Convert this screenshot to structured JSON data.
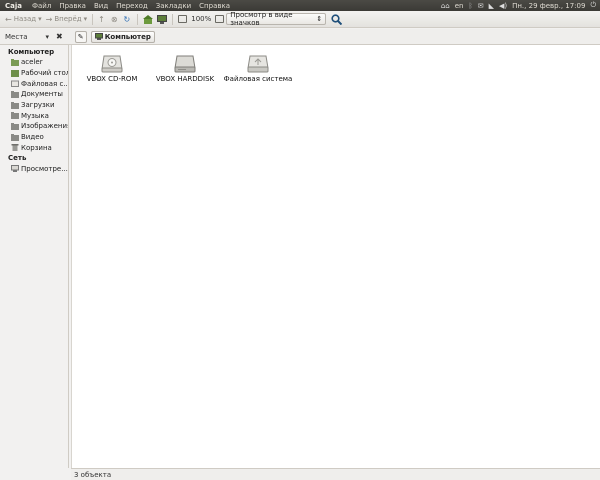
{
  "panel": {
    "app": "Caja",
    "menus": [
      "Файл",
      "Правка",
      "Вид",
      "Переход",
      "Закладки",
      "Справка"
    ],
    "keyboard": "en",
    "clock": "Пн., 29 февр., 17:09"
  },
  "toolbar": {
    "back": "Назад",
    "forward": "Вперёд",
    "zoom": "100%",
    "view_mode": "Просмотр в виде значков"
  },
  "location": {
    "places_label": "Места",
    "breadcrumb": "Компьютер"
  },
  "sidebar": {
    "sections": [
      {
        "title": "Компьютер",
        "items": [
          {
            "label": "aceler",
            "icon": "home-folder-icon"
          },
          {
            "label": "Рабочий стол",
            "icon": "desktop-icon"
          },
          {
            "label": "Файловая с...",
            "icon": "filesystem-icon"
          },
          {
            "label": "Документы",
            "icon": "folder-icon"
          },
          {
            "label": "Загрузки",
            "icon": "folder-icon"
          },
          {
            "label": "Музыка",
            "icon": "folder-icon"
          },
          {
            "label": "Изображения",
            "icon": "folder-icon"
          },
          {
            "label": "Видео",
            "icon": "folder-icon"
          },
          {
            "label": "Корзина",
            "icon": "trash-icon"
          }
        ]
      },
      {
        "title": "Сеть",
        "items": [
          {
            "label": "Просмотре...",
            "icon": "network-icon"
          }
        ]
      }
    ]
  },
  "main": {
    "items": [
      {
        "label": "VBOX CD-ROM",
        "icon": "cdrom-drive-icon"
      },
      {
        "label": "VBOX HARDDISK",
        "icon": "harddisk-icon"
      },
      {
        "label": "Файловая система",
        "icon": "filesystem-drive-icon"
      }
    ]
  },
  "status": {
    "text": "3 объекта"
  }
}
